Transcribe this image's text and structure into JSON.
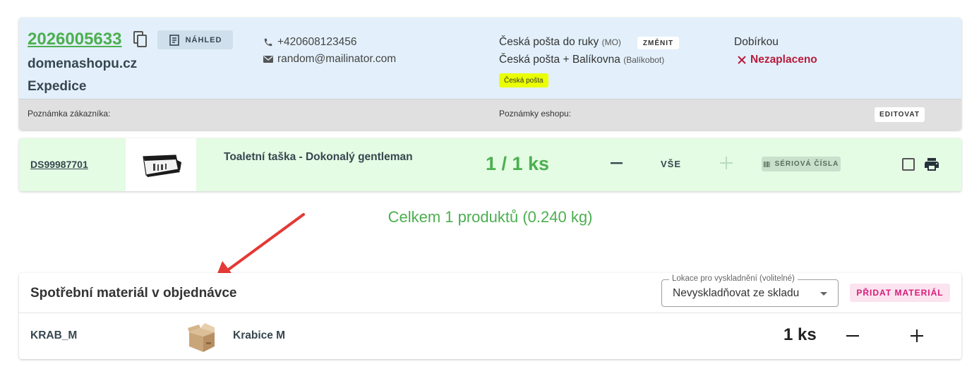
{
  "order": {
    "number": "2026005633",
    "preview_label": "NÁHLED",
    "shop_name": "domenashopu.cz",
    "state": "Expedice",
    "phone": "+420608123456",
    "email": "random@mailinator.com",
    "shipping_1_name": "Česká pošta do ruky",
    "shipping_1_code": "(MO)",
    "shipping_change_label": "ZMĚNIT",
    "shipping_2_name": "Česká pošta + Balíkovna",
    "shipping_2_code": "(Balíkobot)",
    "carrier_badge": "Česká pošta",
    "carrier_badge_color": "#eaff00",
    "payment_method": "Dobírkou",
    "payment_status": "Nezaplaceno",
    "payment_status_color": "#b71c3c",
    "customer_note_label": "Poznámka zákazníka:",
    "shop_note_label": "Poznámky eshopu:",
    "edit_label": "EDITOVAT"
  },
  "product": {
    "sku": "DS99987701",
    "name": "Toaletní taška - Dokonalý gentleman",
    "qty": "1 / 1 ks",
    "all_label": "VŠE",
    "serial_label": "SÉRIOVÁ ČÍSLA",
    "checked": false
  },
  "summary": {
    "total": "Celkem 1 produktů (0.240 kg)"
  },
  "consumables": {
    "title": "Spotřební materiál v objednávce",
    "location_legend": "Lokace pro vyskladnění (volitelné)",
    "location_value": "Nevyskladňovat ze skladu",
    "add_label": "PŘIDAT MATERIÁL",
    "items": [
      {
        "code": "KRAB_M",
        "name": "Krabice M",
        "qty": "1 ks"
      }
    ]
  },
  "colors": {
    "accent_green": "#4caf50",
    "accent_pink": "#d81b7a",
    "annotation_arrow": "#e53935"
  }
}
